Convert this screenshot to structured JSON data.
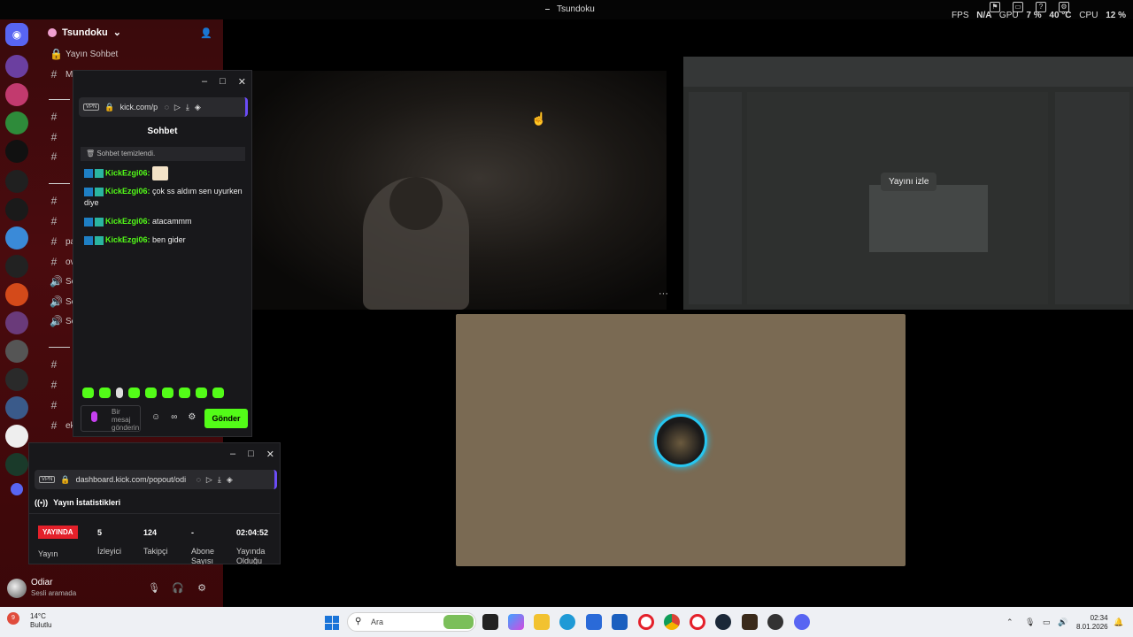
{
  "window": {
    "title": "Tsundoku"
  },
  "perf": {
    "fps_label": "FPS",
    "fps_value": "N/A",
    "gpu_label": "GPU",
    "gpu_value": "7 %",
    "gpu_temp": "40 °C",
    "cpu_label": "CPU",
    "cpu_value": "12 %"
  },
  "discord": {
    "server_name": "Tsundoku",
    "channels": [
      {
        "symbol": "🔒",
        "name": "Yayın Sohbet"
      },
      {
        "symbol": "#",
        "name": "M"
      },
      {
        "symbol": "#",
        "name": ""
      },
      {
        "symbol": "#",
        "name": ""
      },
      {
        "symbol": "#",
        "name": ""
      },
      {
        "symbol": "#",
        "name": ""
      },
      {
        "symbol": "#",
        "name": ""
      },
      {
        "symbol": "#",
        "name": "pa"
      },
      {
        "symbol": "#",
        "name": "ov"
      },
      {
        "symbol": "🔊",
        "name": "Se"
      },
      {
        "symbol": "🔊",
        "name": "Se"
      },
      {
        "symbol": "🔊",
        "name": "Se"
      },
      {
        "symbol": "#",
        "name": ""
      },
      {
        "symbol": "#",
        "name": ""
      },
      {
        "symbol": "#",
        "name": ""
      },
      {
        "symbol": "#",
        "name": "ek"
      }
    ],
    "user": {
      "name": "Odiar",
      "status": "Sesli aramada"
    }
  },
  "stream": {
    "watch_label": "Yayını izle",
    "more": "···"
  },
  "chat_popup": {
    "url": "kick.com/p",
    "title": "Sohbet",
    "cleared_notice": "Sohbet temizlendi.",
    "messages": [
      {
        "user": "KickEzgi06:",
        "text": ""
      },
      {
        "user": "KickEzgi06:",
        "text": "çok ss aldım sen uyurken diye"
      },
      {
        "user": "KickEzgi06:",
        "text": "atacammm"
      },
      {
        "user": "KickEzgi06:",
        "text": "ben gider"
      }
    ],
    "input_placeholder": "Bir mesaj gönderin",
    "send_label": "Gönder"
  },
  "stats_popup": {
    "url": "dashboard.kick.com/popout/odi",
    "title": "Yayın İstatistikleri",
    "live_badge": "YAYINDA",
    "live_label": "Yayın",
    "viewers_value": "5",
    "viewers_label": "İzleyici",
    "followers_value": "124",
    "followers_label": "Takipçi",
    "subs_value": "-",
    "subs_label": "Abone Sayısı",
    "uptime_value": "02:04:52",
    "uptime_label": "Yayında Olduğu"
  },
  "taskbar": {
    "weather_temp": "14°C",
    "weather_desc": "Bulutlu",
    "weather_badge": "9",
    "search_placeholder": "Ara",
    "time": "02:34",
    "date": "8.01.2026"
  },
  "colors": {
    "kick_green": "#53fc18",
    "live_red": "#e4202a",
    "discord_bg": "#4a0b0e",
    "voice_ring": "#26c6f0"
  }
}
